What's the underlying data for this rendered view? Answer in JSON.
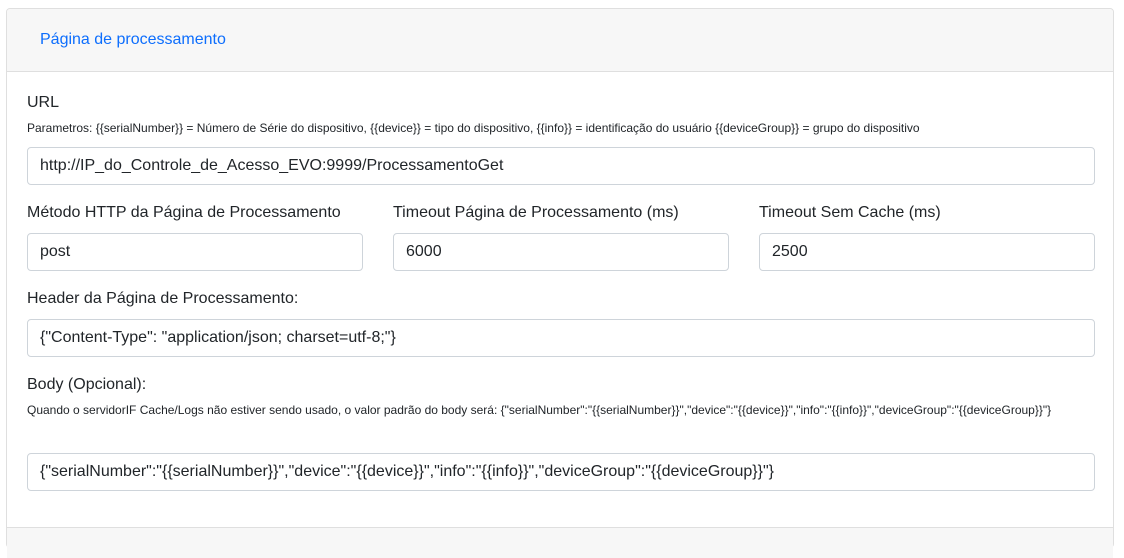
{
  "header": {
    "title": "Página de processamento"
  },
  "url": {
    "label": "URL",
    "help": "Parametros: {{serialNumber}} = Número de Série do dispositivo, {{device}} = tipo do dispositivo, {{info}} = identificação do usuário {{deviceGroup}} = grupo do dispositivo",
    "value": "http://IP_do_Controle_de_Acesso_EVO:9999/ProcessamentoGet"
  },
  "method": {
    "label": "Método HTTP da Página de Processamento",
    "value": "post"
  },
  "timeout": {
    "label": "Timeout Página de Processamento (ms)",
    "value": "6000"
  },
  "timeout_no_cache": {
    "label": "Timeout Sem Cache (ms)",
    "value": "2500"
  },
  "header_field": {
    "label": "Header da Página de Processamento:",
    "value": "{\"Content-Type\": \"application/json; charset=utf-8;\"}"
  },
  "body": {
    "label": "Body (Opcional):",
    "help": "Quando o servidorIF Cache/Logs não estiver sendo usado, o valor padrão do body será: {\"serialNumber\":\"{{serialNumber}}\",\"device\":\"{{device}}\",\"info\":\"{{info}}\",\"deviceGroup\":\"{{deviceGroup}}\"}",
    "value": "{\"serialNumber\":\"{{serialNumber}}\",\"device\":\"{{device}}\",\"info\":\"{{info}}\",\"deviceGroup\":\"{{deviceGroup}}\"}"
  }
}
